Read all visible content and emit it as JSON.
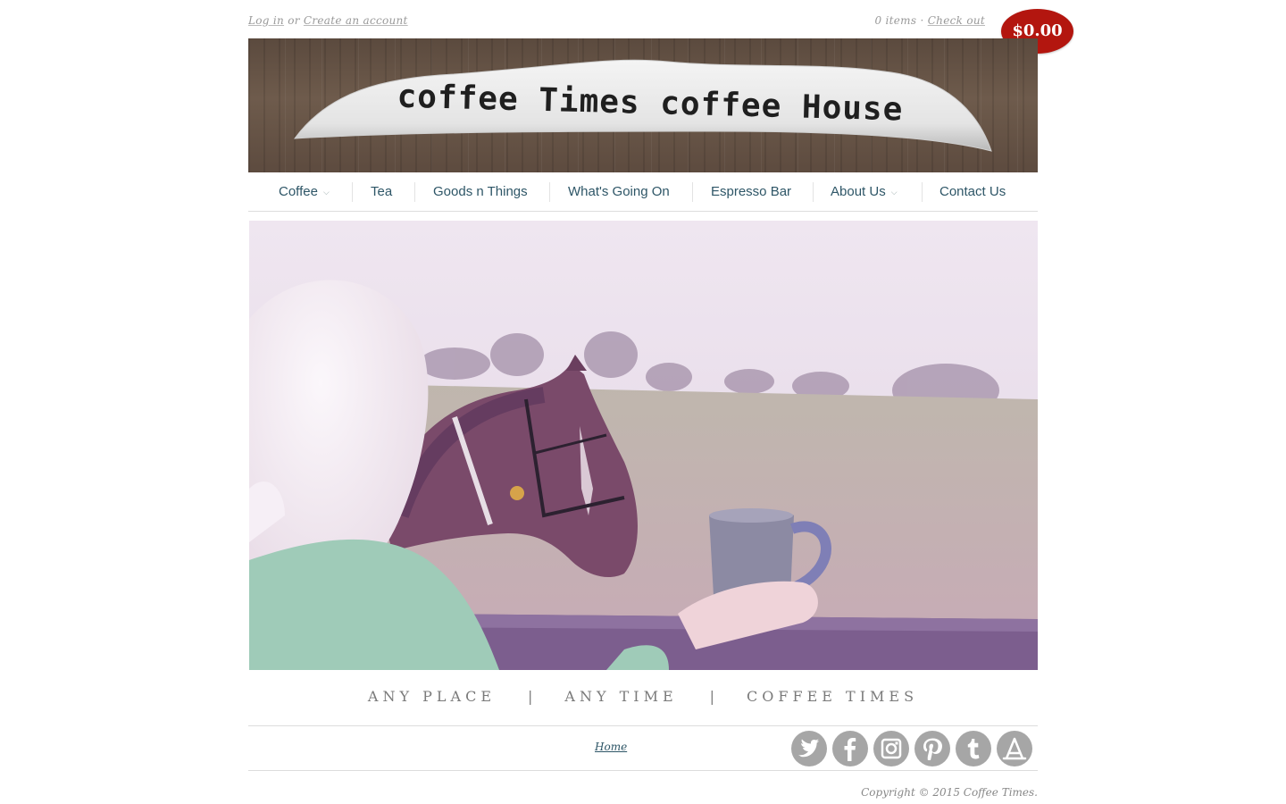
{
  "header": {
    "login_label": "Log in",
    "or_label": "or",
    "create_account_label": "Create an account",
    "cart_items_label": "0 items",
    "dot_separator": "·",
    "checkout_label": "Check out",
    "cart_total": "$0.00",
    "brand_title": "coffee Times coffee House"
  },
  "nav": {
    "items": [
      {
        "label": "Coffee",
        "has_dropdown": true
      },
      {
        "label": "Tea",
        "has_dropdown": false
      },
      {
        "label": "Goods n Things",
        "has_dropdown": false
      },
      {
        "label": "What's Going On",
        "has_dropdown": false
      },
      {
        "label": "Espresso Bar",
        "has_dropdown": false
      },
      {
        "label": "About Us",
        "has_dropdown": true
      },
      {
        "label": "Contact Us",
        "has_dropdown": false
      }
    ],
    "dropdown_glyph": "⌵"
  },
  "tagline": {
    "parts": [
      "ANY PLACE",
      "ANY TIME",
      "COFFEE TIMES"
    ],
    "separator": "|"
  },
  "footer": {
    "home_link": "Home",
    "social": [
      "twitter-icon",
      "facebook-icon",
      "instagram-icon",
      "pinterest-icon",
      "tumblr-icon",
      "app-store-icon"
    ],
    "copyright": "Copyright © 2015 Coffee Times."
  },
  "colors": {
    "cart_badge": "#b3160f",
    "nav_text": "#2e5667",
    "social_icon_bg": "#a6a6a6"
  }
}
